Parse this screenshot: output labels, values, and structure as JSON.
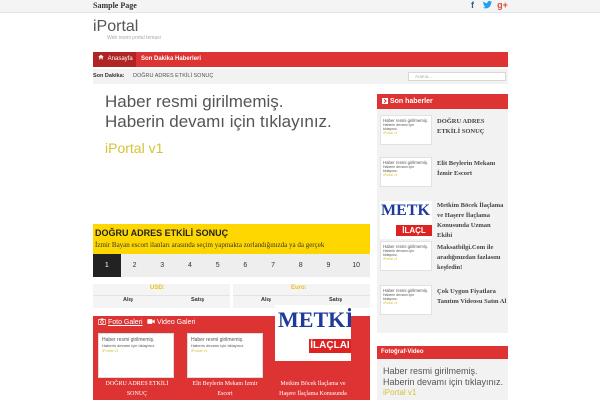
{
  "topbar": {
    "sample_page": "Sample Page"
  },
  "social": {
    "facebook": "f",
    "twitter": "t",
    "google": "g+"
  },
  "logo": {
    "text": "iPortal",
    "tagline": "Web resmi portal temasi"
  },
  "nav": {
    "home": "Anasayfa",
    "news": "Son Dakika Haberleri",
    "home_icon": "home-icon"
  },
  "breaking": {
    "label": "Son Dakika:",
    "text": "DOĞRU ADRES ETKİLİ SONUÇ",
    "search_placeholder": "Arama..."
  },
  "ad": {
    "line1": "Haber resmi girilmemiş.",
    "line2": "Haberin devamı için tıklayınız.",
    "line3": "iPortal v1"
  },
  "headline": {
    "title": "DOĞRU ADRES ETKİLİ SONUÇ",
    "desc": "İzmir Bayan escort ilanları arasında seçim yapmakta zorlandığınızda ya da gerçek"
  },
  "pager": [
    "1",
    "2",
    "3",
    "4",
    "5",
    "6",
    "7",
    "8",
    "9",
    "10"
  ],
  "currency": {
    "usd": "USD:",
    "euro": "Euro:",
    "buy": "Alış",
    "sell": "Satış"
  },
  "gallery": {
    "foto_tab": "Foto Galeri",
    "video_tab": "Video Galeri",
    "thumb_l1": "Haber resmi girilmemiş.",
    "thumb_l2": "Haberin devamı için tıklayınız.",
    "thumb_l3": "iPortal v1",
    "captions": [
      "DOĞRU ADRES ETKİLİ SONUÇ",
      "Elit Beylerin Mekanı İzmir Escort",
      "Metkim Böcek İlaçlama ve Haşere İlaçlama Konusunda"
    ],
    "metkim_logo": "METKİM",
    "metkim_ilac": "İLAÇLAI"
  },
  "sidebar": {
    "heading": "Son haberler",
    "thumb_l1": "Haber resmi girilmemiş.",
    "thumb_l2": "Haberin devamı için tıklayınız.",
    "thumb_l3": "iPortal v1",
    "metkim_logo": "METK",
    "metkim_ilac": "İLAÇL",
    "items": [
      "DOĞRU ADRES ETKİLİ SONUÇ",
      "Elit Beylerin Mekanı İzmir Escort",
      "Metkim Böcek İlaçlama ve Haşere İlaçlama Konusunda Uzman Ekibi",
      "Maksatbilgi.Com ile aradığınızdan fazlasını keşfedin!",
      "Çok Uygun Fiyatlara Tanıtım Videosu Satın Al"
    ]
  },
  "foto_video": {
    "heading": "Fotoğraf-Video",
    "line1": "Haber resmi girilmemiş.",
    "line2": "Haberin devamı için tıklayınız.",
    "line3": "iPortal v1"
  },
  "colors": {
    "accent": "#dd3333",
    "headline_bg": "#ffd700",
    "gold": "#d4c33a"
  }
}
